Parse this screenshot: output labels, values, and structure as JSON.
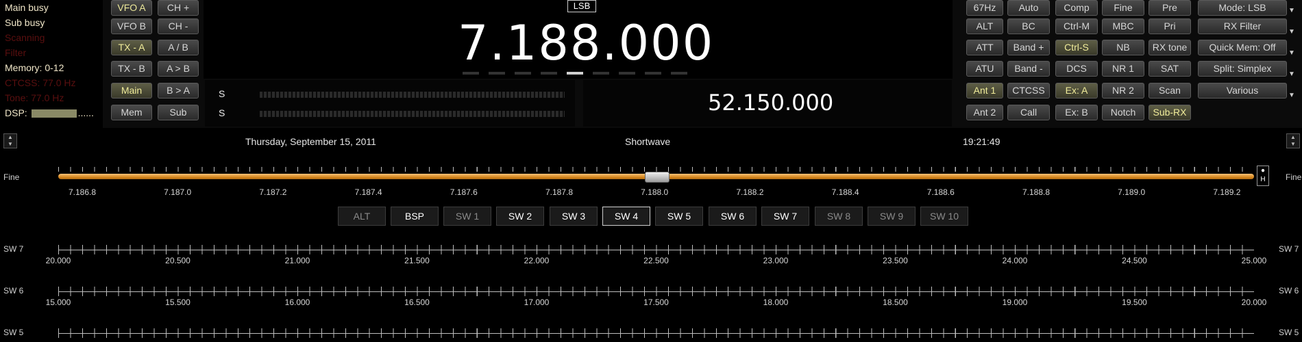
{
  "status": {
    "main_busy": "Main busy",
    "sub_busy": "Sub busy",
    "scanning": "Scanning",
    "filter": "Filter",
    "memory": "Memory: 0-12",
    "ctcss": "CTCSS: 77.0 Hz",
    "tone": "Tone: 77.0 Hz",
    "dsp_label": "DSP:",
    "dsp_dots": "......"
  },
  "vfo_buttons": {
    "vfo_a": "VFO A",
    "ch_plus": "CH +",
    "vfo_b": "VFO B",
    "ch_minus": "CH -",
    "tx_a": "TX - A",
    "a_b": "A / B",
    "tx_b": "TX - B",
    "a_to_b": "A > B",
    "main": "Main",
    "b_to_a": "B > A",
    "mem": "Mem",
    "sub": "Sub"
  },
  "display": {
    "mode": "LSB",
    "main_frequency": "7.188.000",
    "sub_frequency": "52.150.000",
    "s_label_1": "S",
    "s_label_2": "S"
  },
  "func_buttons": {
    "r1": [
      "67Hz",
      "Auto",
      "Comp",
      "Fine",
      "Pre"
    ],
    "r2": [
      "ALT",
      "BC",
      "Ctrl-M",
      "MBC",
      "Pri"
    ],
    "r3": [
      "ATT",
      "Band +",
      "Ctrl-S",
      "NB",
      "RX tone"
    ],
    "r4": [
      "ATU",
      "Band -",
      "DCS",
      "NR 1",
      "SAT"
    ],
    "r5": [
      "Ant 1",
      "CTCSS",
      "Ex: A",
      "NR 2",
      "Scan"
    ],
    "r6": [
      "Ant 2",
      "Call",
      "Ex: B",
      "Notch",
      "Sub-RX"
    ]
  },
  "dropdowns": {
    "mode": "Mode: LSB",
    "rx_filter": "RX Filter",
    "quick_mem": "Quick Mem: Off",
    "split": "Split: Simplex",
    "various": "Various"
  },
  "info": {
    "date": "Thursday, September 15, 2011",
    "band_name": "Shortwave",
    "time": "19:21:49"
  },
  "tuning_scale": {
    "label": "Fine",
    "right_label": "Fine",
    "ticks": [
      "7.186.8",
      "7.187.0",
      "7.187.2",
      "7.187.4",
      "7.187.6",
      "7.187.8",
      "7.188.0",
      "7.188.2",
      "7.188.4",
      "7.188.6",
      "7.188.8",
      "7.189.0",
      "7.189.2"
    ],
    "pin_icon": "pin-icon"
  },
  "band_tabs": [
    "ALT",
    "BSP",
    "SW 1",
    "SW 2",
    "SW 3",
    "SW 4",
    "SW 5",
    "SW 6",
    "SW 7",
    "SW 8",
    "SW 9",
    "SW 10"
  ],
  "selected_tab": "SW 4",
  "band_scales": [
    {
      "name": "SW 7",
      "ticks": [
        "20.000",
        "20.500",
        "21.000",
        "21.500",
        "22.000",
        "22.500",
        "23.000",
        "23.500",
        "24.000",
        "24.500",
        "25.000"
      ]
    },
    {
      "name": "SW 6",
      "ticks": [
        "15.000",
        "15.500",
        "16.000",
        "16.500",
        "17.000",
        "17.500",
        "18.000",
        "18.500",
        "19.000",
        "19.500",
        "20.000"
      ]
    },
    {
      "name": "SW 5",
      "ticks": []
    }
  ],
  "colors": {
    "tuning_bar": "#e59a35",
    "active_button_text": "#f0ec9a"
  }
}
